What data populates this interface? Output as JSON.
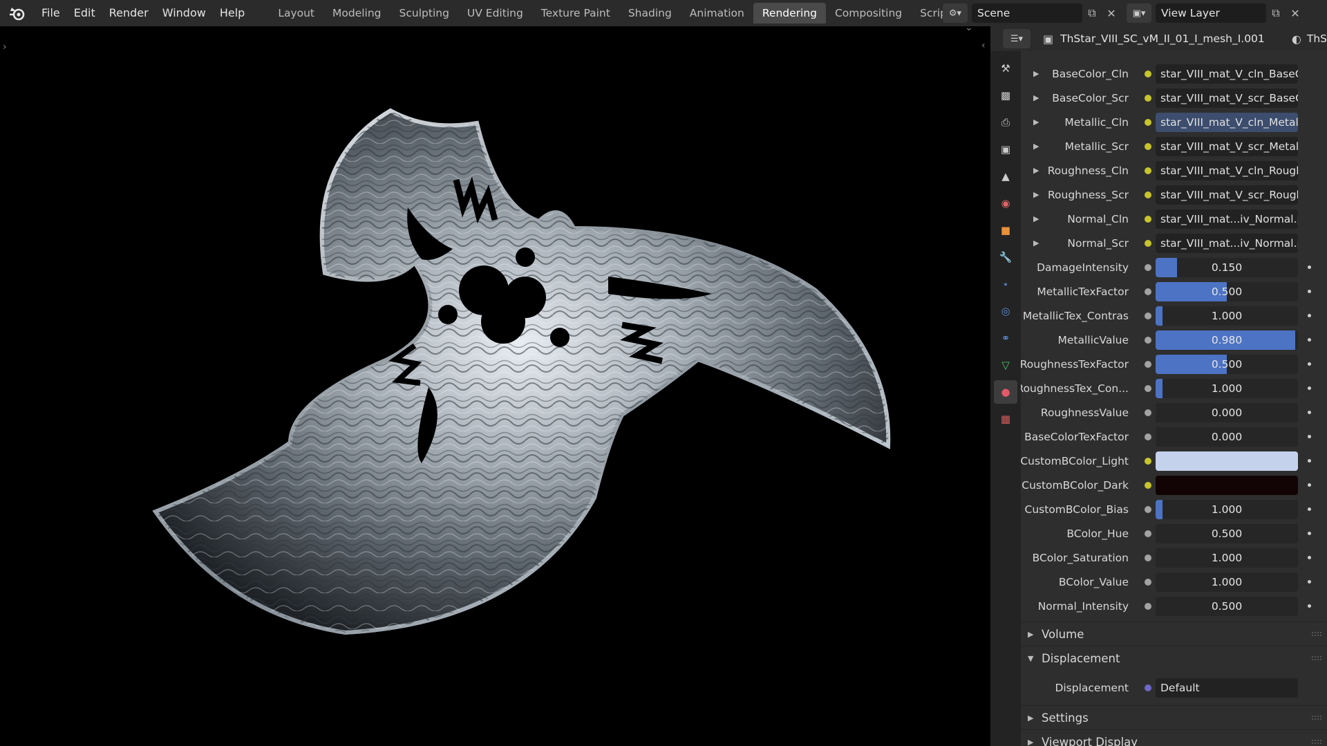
{
  "menu": [
    "File",
    "Edit",
    "Render",
    "Window",
    "Help"
  ],
  "workspaces": [
    "Layout",
    "Modeling",
    "Sculpting",
    "UV Editing",
    "Texture Paint",
    "Shading",
    "Animation",
    "Rendering",
    "Compositing",
    "Scripting"
  ],
  "active_workspace": "Rendering",
  "scene": {
    "name": "Scene",
    "view_layer": "View Layer"
  },
  "props_header": {
    "object_name": "ThStar_VIII_SC_vM_II_01_I_mesh_I.001",
    "extra": "ThS"
  },
  "image_rows": [
    {
      "label": "BaseColor_Cln",
      "value": "star_VIII_mat_V_cln_BaseCo..."
    },
    {
      "label": "BaseColor_Scr",
      "value": "star_VIII_mat_V_scr_BaseCo..."
    },
    {
      "label": "Metallic_Cln",
      "value": "star_VIII_mat_V_cln_Metalli..."
    },
    {
      "label": "Metallic_Scr",
      "value": "star_VIII_mat_V_scr_Metalli..."
    },
    {
      "label": "Roughness_Cln",
      "value": "star_VIII_mat_V_cln_Roughn..."
    },
    {
      "label": "Roughness_Scr",
      "value": "star_VIII_mat_V_scr_Roughn..."
    },
    {
      "label": "Normal_Cln",
      "value": "star_VIII_mat...iv_Normal.png"
    },
    {
      "label": "Normal_Scr",
      "value": "star_VIII_mat...iv_Normal.png"
    }
  ],
  "value_rows": [
    {
      "label": "DamageIntensity",
      "value": "0.150",
      "fill": 0.15
    },
    {
      "label": "MetallicTexFactor",
      "value": "0.500",
      "fill": 0.5
    },
    {
      "label": "MetallicTex_Contras",
      "value": "1.000",
      "fill": 0.05
    },
    {
      "label": "MetallicValue",
      "value": "0.980",
      "fill": 0.98
    },
    {
      "label": "RoughnessTexFactor",
      "value": "0.500",
      "fill": 0.5
    },
    {
      "label": "RoughnessTex_Con...",
      "value": "1.000",
      "fill": 0.05
    }
  ],
  "zero_rows": [
    {
      "label": "RoughnessValue",
      "value": "0.000"
    },
    {
      "label": "BaseColorTexFactor",
      "value": "0.000"
    }
  ],
  "color_rows": [
    {
      "label": "CustomBColor_Light",
      "color": "#c5d2ec"
    },
    {
      "label": "CustomBColor_Dark",
      "color": "#120404"
    }
  ],
  "tail_rows": [
    {
      "label": "CustomBColor_Bias",
      "value": "1.000",
      "fill": 0.05
    },
    {
      "label": "BColor_Hue",
      "value": "0.500"
    },
    {
      "label": "BColor_Saturation",
      "value": "1.000"
    },
    {
      "label": "BColor_Value",
      "value": "1.000"
    },
    {
      "label": "Normal_Intensity",
      "value": "0.500"
    }
  ],
  "sections": {
    "volume": "Volume",
    "displacement": "Displacement",
    "settings": "Settings",
    "viewport_display": "Viewport Display"
  },
  "displacement_row": {
    "label": "Displacement",
    "value": "Default"
  },
  "colors": {
    "accent": "#4d73c4",
    "topbar": "#2b2b2b",
    "panel": "#2e2e2e"
  }
}
